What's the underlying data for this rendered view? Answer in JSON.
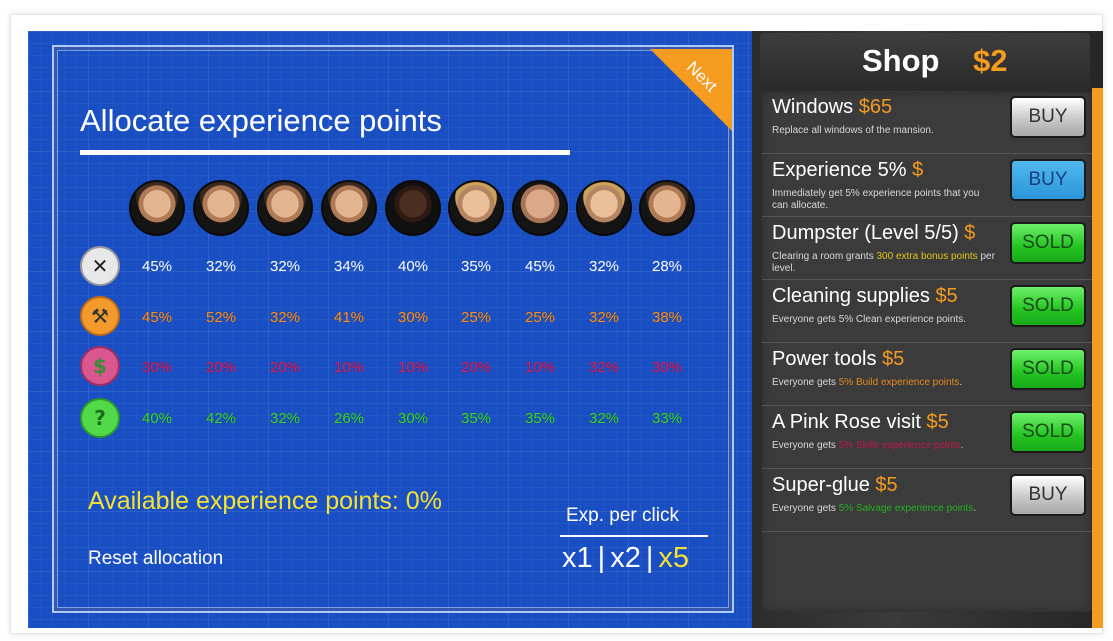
{
  "board": {
    "title": "Allocate experience points",
    "next_label": "Next",
    "avatars": [
      "standard",
      "standard",
      "standard",
      "standard",
      "dark",
      "blond",
      "bald",
      "blond",
      "standard"
    ],
    "rows": [
      {
        "icon": "cleaning-tools-icon",
        "values": [
          "45%",
          "32%",
          "32%",
          "34%",
          "40%",
          "35%",
          "45%",
          "32%",
          "28%"
        ]
      },
      {
        "icon": "hammer-icon",
        "values": [
          "45%",
          "52%",
          "32%",
          "41%",
          "30%",
          "25%",
          "25%",
          "32%",
          "38%"
        ]
      },
      {
        "icon": "money-icon",
        "values": [
          "30%",
          "20%",
          "20%",
          "10%",
          "10%",
          "20%",
          "10%",
          "32%",
          "30%"
        ]
      },
      {
        "icon": "question-icon",
        "values": [
          "40%",
          "42%",
          "32%",
          "26%",
          "30%",
          "35%",
          "35%",
          "32%",
          "33%"
        ]
      }
    ],
    "available": "Available experience points: 0%",
    "reset": "Reset allocation",
    "exp_per_click": "Exp. per click",
    "multipliers": [
      "x1",
      "x2",
      "x5"
    ],
    "selected_multiplier": "x5"
  },
  "shop": {
    "title": "Shop",
    "money": "$2",
    "items": [
      {
        "name": "Windows",
        "price": "$65",
        "desc": [
          {
            "t": "Replace all windows of the mansion."
          }
        ],
        "button": "BUY",
        "state": "buy"
      },
      {
        "name": "Experience 5%",
        "price": "$",
        "desc": [
          {
            "t": "Immediately get 5% experience points that you can allocate."
          }
        ],
        "button": "BUY",
        "state": "buy-blue"
      },
      {
        "name": "Dumpster (Level 5/5)",
        "price": "$",
        "desc": [
          {
            "t": "Clearing a room grants "
          },
          {
            "t": "300 extra bonus points",
            "c": "yellow"
          },
          {
            "t": " per level."
          }
        ],
        "button": "SOLD",
        "state": "sold"
      },
      {
        "name": "Cleaning supplies",
        "price": "$5",
        "desc": [
          {
            "t": "Everyone gets 5% Clean experience points."
          }
        ],
        "button": "SOLD",
        "state": "sold"
      },
      {
        "name": "Power tools",
        "price": "$5",
        "desc": [
          {
            "t": "Everyone gets "
          },
          {
            "t": "5% Build experience points",
            "c": "orange"
          },
          {
            "t": "."
          }
        ],
        "button": "SOLD",
        "state": "sold"
      },
      {
        "name": "A Pink Rose visit",
        "price": "$5",
        "desc": [
          {
            "t": "Everyone gets "
          },
          {
            "t": "5% Skills experience points",
            "c": "pink"
          },
          {
            "t": "."
          }
        ],
        "button": "SOLD",
        "state": "sold"
      },
      {
        "name": "Super-glue",
        "price": "$5",
        "desc": [
          {
            "t": "Everyone gets "
          },
          {
            "t": "5% Salvage experience points",
            "c": "green"
          },
          {
            "t": "."
          }
        ],
        "button": "BUY",
        "state": "buy"
      }
    ]
  }
}
